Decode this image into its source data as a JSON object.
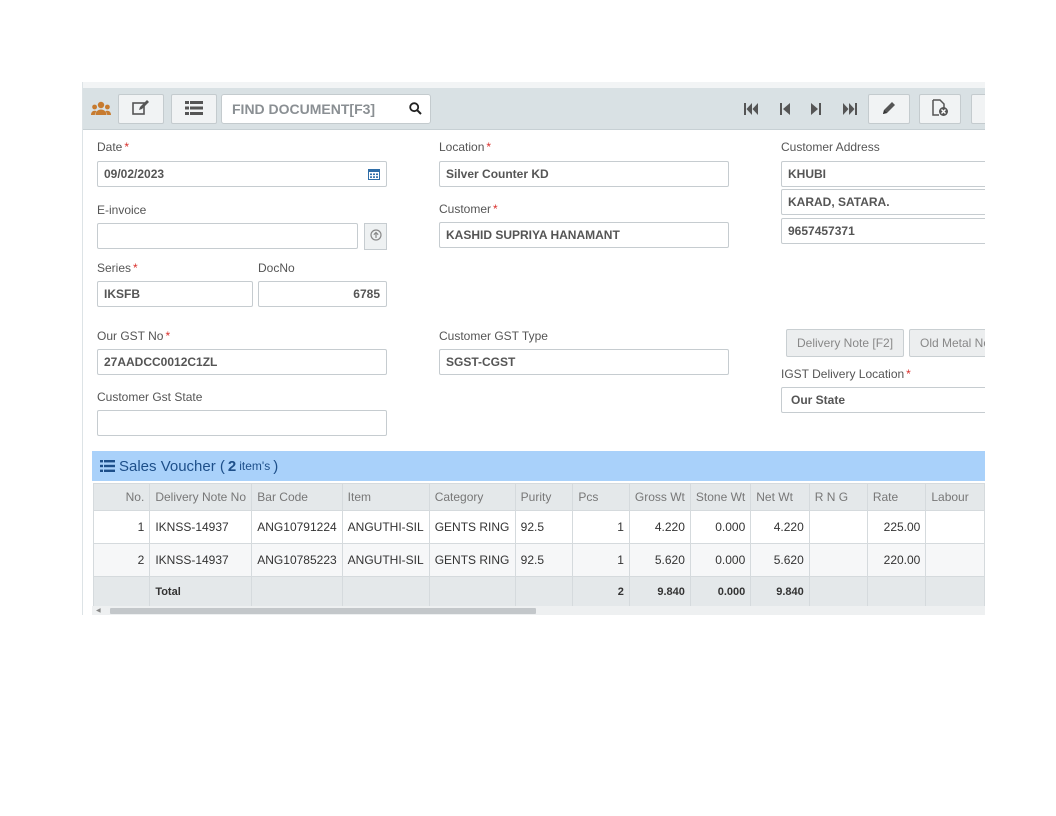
{
  "toolbar": {
    "find_placeholder": "FIND DOCUMENT[F3]",
    "icons": [
      "users-icon",
      "edit-icon",
      "list-icon",
      "search-icon",
      "first-record-icon",
      "previous-record-icon",
      "next-record-icon",
      "last-record-icon",
      "pencil-icon",
      "cancel-document-icon"
    ]
  },
  "form": {
    "date": {
      "label": "Date",
      "value": "09/02/2023"
    },
    "einvoice": {
      "label": "E-invoice",
      "value": ""
    },
    "series": {
      "label": "Series",
      "value": "IKSFB"
    },
    "docno": {
      "label": "DocNo",
      "value": "6785"
    },
    "our_gst": {
      "label": "Our GST No",
      "value": "27AADCC0012C1ZL"
    },
    "cust_gst_state": {
      "label": "Customer Gst State",
      "value": ""
    },
    "location": {
      "label": "Location",
      "value": "Silver Counter KD"
    },
    "customer": {
      "label": "Customer",
      "value": "KASHID SUPRIYA HANAMANT"
    },
    "cust_gst_type": {
      "label": "Customer GST Type",
      "value": "SGST-CGST"
    },
    "cust_address": {
      "label": "Customer Address",
      "lines": [
        "KHUBI",
        "KARAD, SATARA.",
        "9657457371"
      ]
    },
    "delivery_note_btn": "Delivery Note [F2]",
    "old_metal_btn": "Old Metal No",
    "igst_location": {
      "label": "IGST Delivery Location",
      "value": "Our State"
    }
  },
  "sales_voucher": {
    "title": "Sales Voucher (",
    "count": "2",
    "count_suffix": "item's",
    "close": ")",
    "columns": [
      "No.",
      "Delivery Note No",
      "Bar Code",
      "Item",
      "Category",
      "Purity",
      "Pcs",
      "Gross Wt",
      "Stone Wt",
      "Net Wt",
      "R N G",
      "Rate",
      "Labour"
    ],
    "rows": [
      [
        "1",
        "IKNSS-14937",
        "ANG10791224",
        "ANGUTHI-SIL",
        "GENTS RING",
        "92.5",
        "1",
        "4.220",
        "0.000",
        "4.220",
        "",
        "225.00",
        ""
      ],
      [
        "2",
        "IKNSS-14937",
        "ANG10785223",
        "ANGUTHI-SIL",
        "GENTS RING",
        "92.5",
        "1",
        "5.620",
        "0.000",
        "5.620",
        "",
        "220.00",
        ""
      ]
    ],
    "total": [
      "",
      "Total",
      "",
      "",
      "",
      "",
      "2",
      "9.840",
      "0.000",
      "9.840",
      "",
      "",
      ""
    ]
  }
}
